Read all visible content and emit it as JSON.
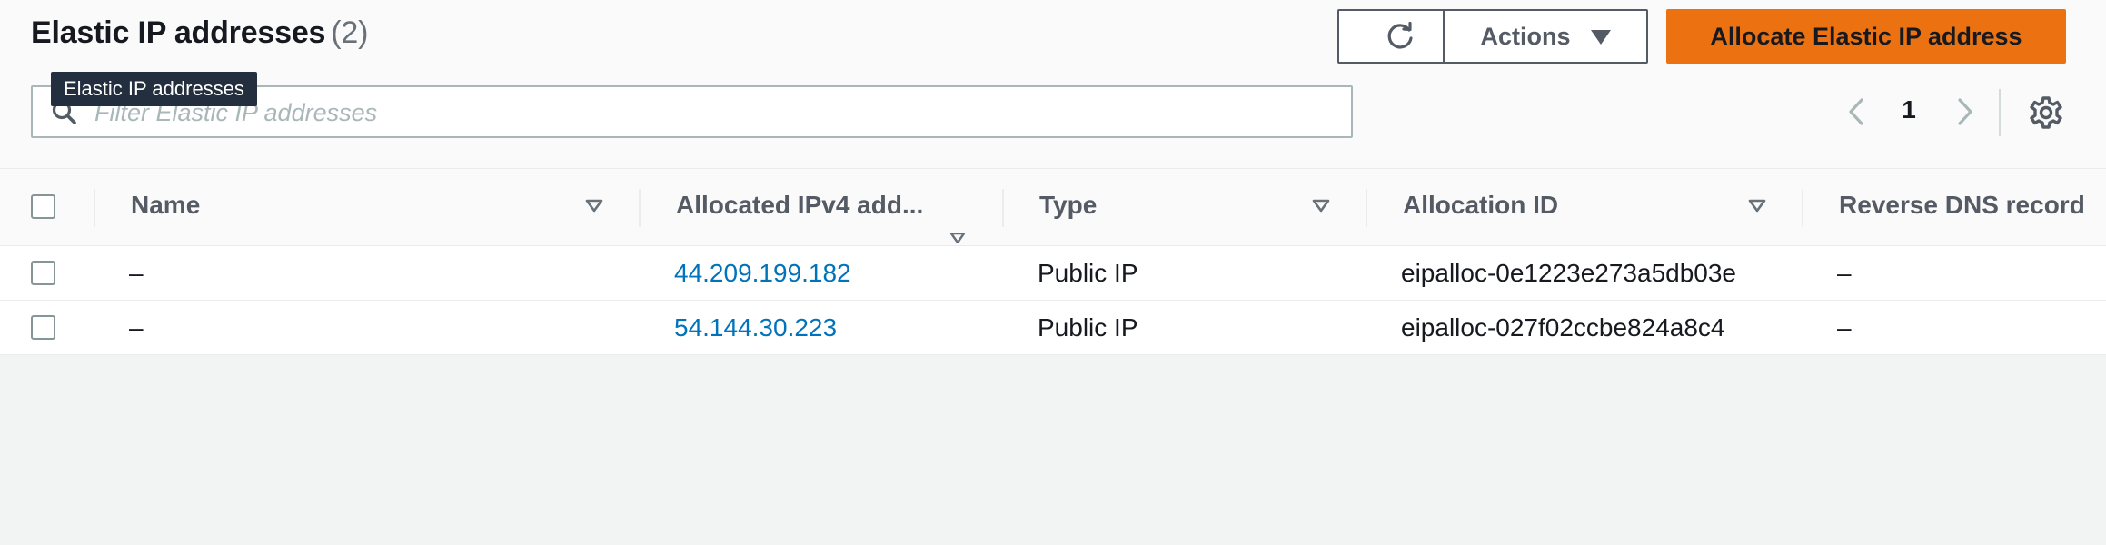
{
  "header": {
    "title": "Elastic IP addresses",
    "count": "(2)",
    "tooltip": "Elastic IP addresses",
    "actions_label": "Actions",
    "allocate_label": "Allocate Elastic IP address"
  },
  "search": {
    "placeholder": "Filter Elastic IP addresses",
    "value": ""
  },
  "pagination": {
    "current_page": "1"
  },
  "table": {
    "columns": [
      "Name",
      "Allocated IPv4 add...",
      "Type",
      "Allocation ID",
      "Reverse DNS record"
    ],
    "rows": [
      {
        "name": "–",
        "ipv4": "44.209.199.182",
        "type": "Public IP",
        "allocation_id": "eipalloc-0e1223e273a5db03e",
        "reverse_dns": "–"
      },
      {
        "name": "–",
        "ipv4": "54.144.30.223",
        "type": "Public IP",
        "allocation_id": "eipalloc-027f02ccbe824a8c4",
        "reverse_dns": "–"
      }
    ]
  },
  "icons": {
    "refresh": "refresh-icon",
    "caret": "caret-down-icon",
    "search": "search-icon",
    "prev": "chevron-left-icon",
    "next": "chevron-right-icon",
    "settings": "gear-icon",
    "sort": "sort-down-icon"
  },
  "colors": {
    "primary_button": "#ec7211",
    "link": "#0073bb",
    "background": "#f2f3f3"
  }
}
